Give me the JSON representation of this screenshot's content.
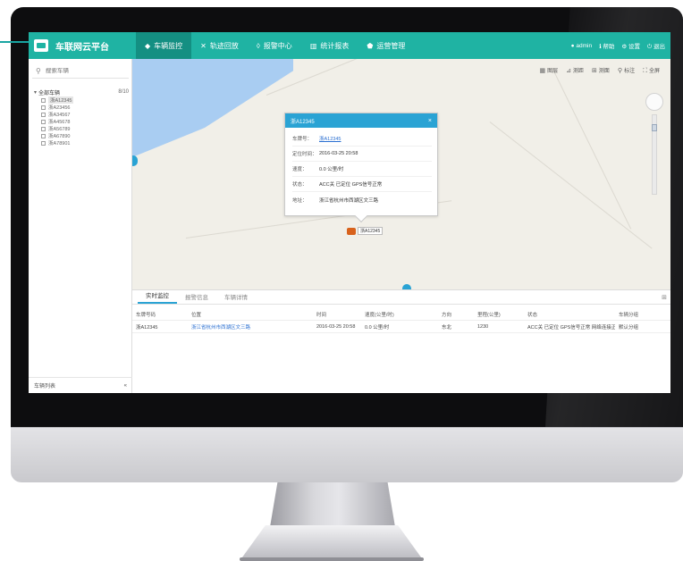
{
  "app": {
    "brand_name": "车联网云平台",
    "accent_color": "#1fb3a3",
    "popup_color": "#2aa3d4"
  },
  "nav": {
    "items": [
      {
        "icon": "location-pin-icon",
        "glyph": "◆",
        "label": "车辆监控",
        "active": true
      },
      {
        "icon": "route-icon",
        "glyph": "✕",
        "label": "轨迹回放",
        "active": false
      },
      {
        "icon": "alarm-icon",
        "glyph": "◊",
        "label": "报警中心",
        "active": false
      },
      {
        "icon": "chart-icon",
        "glyph": "▥",
        "label": "统计报表",
        "active": false
      },
      {
        "icon": "shield-icon",
        "glyph": "⬟",
        "label": "运营管理",
        "active": false
      }
    ]
  },
  "user": {
    "name": "admin",
    "help": "帮助",
    "settings": "设置",
    "logout": "退出"
  },
  "sidebar": {
    "search_placeholder": "搜索车辆",
    "root_label": "全部车辆",
    "root_count": "8/10",
    "children": [
      "浙A12345",
      "浙A23456",
      "浙A34567",
      "浙A45678",
      "浙A56789",
      "浙A67890",
      "浙A78901"
    ],
    "footer_label": "车辆列表",
    "footer_arrow": "«"
  },
  "map": {
    "tools": [
      {
        "icon": "layers-icon",
        "glyph": "▦",
        "label": "图层"
      },
      {
        "icon": "ruler-icon",
        "glyph": "⊿",
        "label": "测距"
      },
      {
        "icon": "area-icon",
        "glyph": "⊞",
        "label": "测面"
      },
      {
        "icon": "pin-icon",
        "glyph": "⚲",
        "label": "标注"
      },
      {
        "icon": "fullscreen-icon",
        "glyph": "⛶",
        "label": "全屏"
      }
    ],
    "marker_label": "浙A12345"
  },
  "popup": {
    "title": "浙A12345",
    "close_glyph": "×",
    "rows": [
      {
        "key": "车牌号：",
        "value": "浙A12345",
        "link": true
      },
      {
        "key": "定位时间：",
        "value": "2016-03-25 20:58",
        "link": false
      },
      {
        "key": "速度：",
        "value": "0.0 公里/时",
        "link": false
      },
      {
        "key": "状态：",
        "value": "ACC关 已定位 GPS信号正常",
        "link": false
      },
      {
        "key": "地址：",
        "value": "浙江省杭州市西湖区文三路",
        "link": false
      }
    ]
  },
  "panel": {
    "tabs": [
      "实时监控",
      "报警信息",
      "车辆详情"
    ],
    "active_tab": 0,
    "expand_glyph": "⊞",
    "columns": [
      "车牌号码",
      "位置",
      "时间",
      "速度(公里/时)",
      "方向",
      "里程(公里)",
      "状态",
      "车辆分组"
    ],
    "rows": [
      [
        "浙A12345",
        "浙江省杭州市西湖区文三路",
        "2016-03-25 20:58",
        "0.0 公里/时",
        "东北",
        "1230",
        "ACC关 已定位 GPS信号正常 网络连接正常",
        "默认分组"
      ]
    ]
  }
}
